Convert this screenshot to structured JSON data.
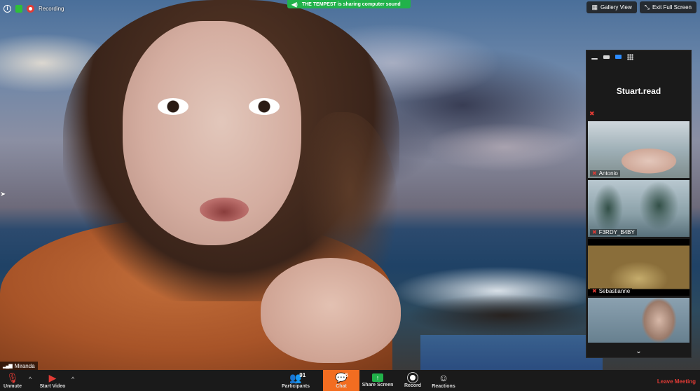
{
  "top_bar": {
    "recording_label": "Recording",
    "sound_banner": "THE TEMPEST is sharing computer sound",
    "gallery_view_label": "Gallery View",
    "exit_full_screen_label": "Exit Full Screen"
  },
  "side_panel": {
    "active_speaker": "Stuart.read",
    "participants": [
      {
        "name": "Antonio"
      },
      {
        "name": "F3RDY_B4BY"
      },
      {
        "name": "Sebastianne"
      },
      {
        "name": ""
      }
    ]
  },
  "self_view": {
    "name": "Miranda"
  },
  "toolbar": {
    "unmute_label": "Unmute",
    "start_video_label": "Start Video",
    "participants_label": "Participants",
    "participants_count": "91",
    "chat_label": "Chat",
    "chat_count": "6",
    "share_screen_label": "Share Screen",
    "record_label": "Record",
    "reactions_label": "Reactions",
    "leave_label": "Leave Meeting"
  },
  "colors": {
    "accent_green": "#21b24a",
    "chat_orange": "#f26d21",
    "danger_red": "#e13b35",
    "toolbar_bg": "#1a1a1a"
  },
  "icons": [
    "info-icon",
    "lock-icon",
    "record-dot-icon",
    "speaker-icon",
    "grid-icon",
    "exit-fullscreen-icon",
    "mic-muted-icon",
    "video-off-icon",
    "participants-icon",
    "chat-icon",
    "share-screen-icon",
    "record-icon",
    "reactions-icon",
    "chevron-down-icon"
  ]
}
